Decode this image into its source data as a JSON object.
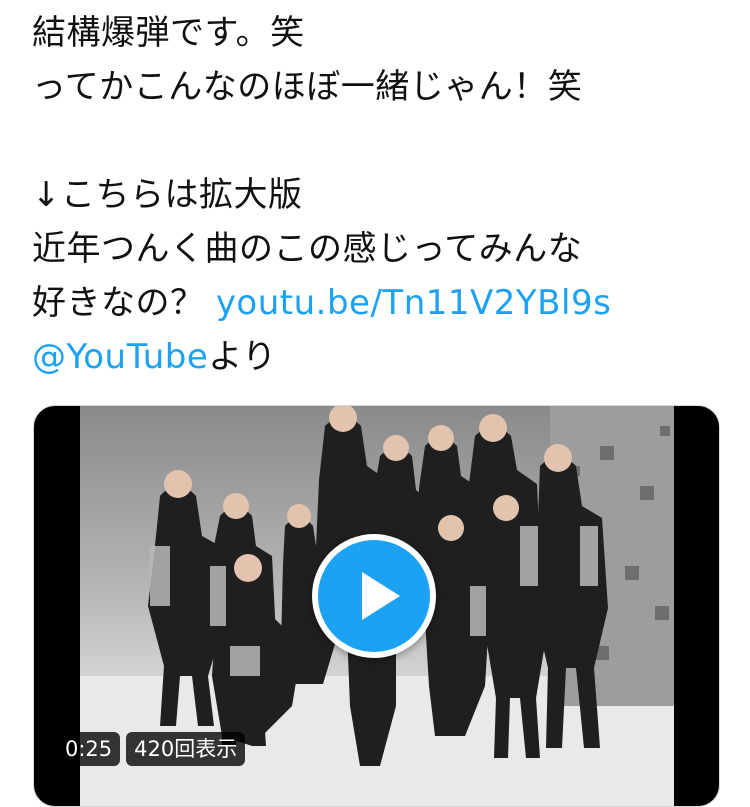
{
  "tweet": {
    "lines": [
      "結構爆弾です。笑",
      "ってかこんなのほぼ一緒じゃん！笑",
      "",
      "↓こちらは拡大版",
      "近年つんく曲のこの感じってみんな"
    ],
    "line6_prefix": "好きなの？ ",
    "link_url": "youtu.be/Tn11V2YBl9s",
    "mention": "@YouTube",
    "mention_suffix": "より"
  },
  "video": {
    "duration": "0:25",
    "views": "420回表示"
  },
  "colors": {
    "link": "#1da1f2",
    "play_button": "#1da1f2"
  }
}
